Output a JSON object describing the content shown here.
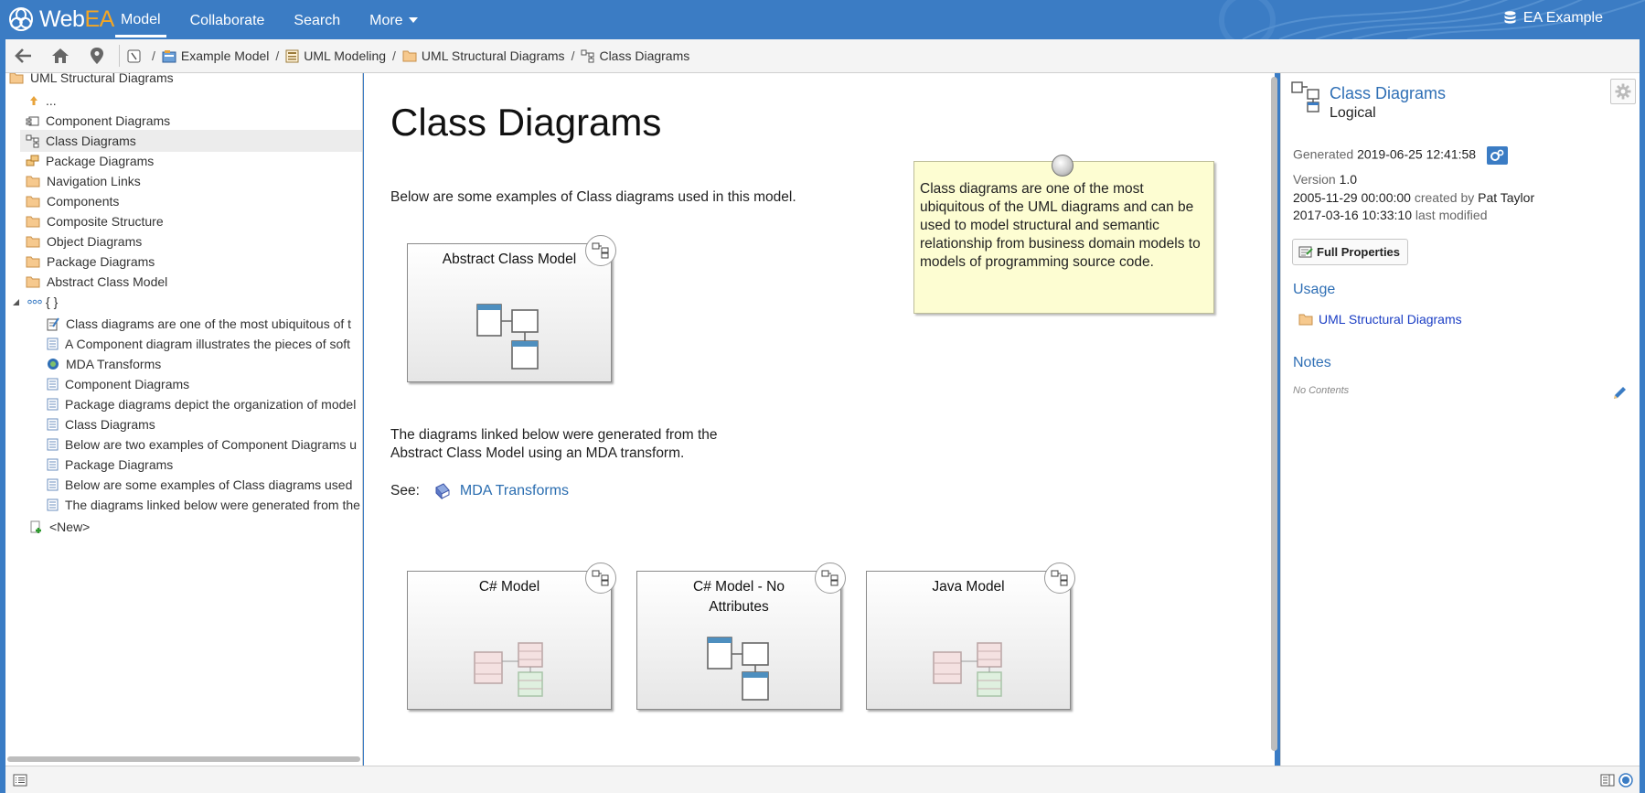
{
  "app": {
    "brand_a": "Web",
    "brand_b": "EA",
    "model_name": "EA Example"
  },
  "menu": [
    {
      "label": "Model",
      "active": true
    },
    {
      "label": "Collaborate"
    },
    {
      "label": "Search"
    },
    {
      "label": "More",
      "dropdown": true
    }
  ],
  "breadcrumb": [
    "Example Model",
    "UML Modeling",
    "UML Structural Diagrams",
    "Class Diagrams"
  ],
  "tree": {
    "root": "UML Structural Diagrams",
    "up": "...",
    "items": [
      {
        "label": "Component Diagrams",
        "icon": "component-diagram-icon"
      },
      {
        "label": "Class Diagrams",
        "icon": "class-diagram-icon",
        "selected": true
      },
      {
        "label": "Package Diagrams",
        "icon": "package-diagram-icon"
      },
      {
        "label": "Navigation Links",
        "icon": "folder-icon"
      },
      {
        "label": "Components",
        "icon": "folder-icon"
      },
      {
        "label": "Composite Structure",
        "icon": "folder-icon"
      },
      {
        "label": "Object Diagrams",
        "icon": "folder-icon"
      },
      {
        "label": "Package Diagrams",
        "icon": "folder-icon"
      },
      {
        "label": "Abstract Class Model",
        "icon": "folder-icon"
      }
    ],
    "group_label": "{ }",
    "group_items": [
      {
        "label": "Class diagrams are one of the most ubiquitous of t",
        "icon": "note-icon"
      },
      {
        "label": "A Component diagram illustrates the pieces of soft",
        "icon": "text-icon"
      },
      {
        "label": "MDA Transforms",
        "icon": "hyperlink-icon"
      },
      {
        "label": "Component Diagrams",
        "icon": "text-icon"
      },
      {
        "label": "Package diagrams depict the organization of model",
        "icon": "text-icon"
      },
      {
        "label": "Class Diagrams",
        "icon": "text-icon"
      },
      {
        "label": "Below are two examples of Component Diagrams u",
        "icon": "text-icon"
      },
      {
        "label": "Package Diagrams",
        "icon": "text-icon"
      },
      {
        "label": "Below are some examples of Class diagrams used",
        "icon": "text-icon"
      },
      {
        "label": "The diagrams linked below were generated from the",
        "icon": "text-icon"
      }
    ],
    "new_label": "<New>"
  },
  "diagram": {
    "title": "Class Diagrams",
    "intro": "Below are some examples of Class diagrams used in this model.",
    "note": "Class diagrams are one of the most ubiquitous of the UML diagrams and can be used to model structural and semantic relationship from business domain models to models of programming source code.",
    "abstract_frame": "Abstract Class Model",
    "generated_line1": "The diagrams linked below were generated from the",
    "generated_line2": "Abstract Class Model using an MDA transform.",
    "see_label": "See:",
    "see_link": "MDA Transforms",
    "frames": [
      {
        "title": "C# Model",
        "style": "pastel"
      },
      {
        "title": "C# Model - No Attributes",
        "style": "plain"
      },
      {
        "title": "Java Model",
        "style": "pastel"
      }
    ]
  },
  "properties": {
    "name": "Class Diagrams",
    "type": "Logical",
    "generated_label": "Generated",
    "generated": "2019-06-25 12:41:58",
    "version_label": "Version",
    "version": "1.0",
    "created": "2005-11-29 00:00:00",
    "created_by_label": "created by",
    "author": "Pat Taylor",
    "modified": "2017-03-16 10:33:10",
    "modified_label": "last modified",
    "full_properties": "Full Properties",
    "usage_heading": "Usage",
    "usage_link": "UML Structural Diagrams",
    "notes_heading": "Notes",
    "notes_empty": "No Contents"
  },
  "colors": {
    "header": "#3b7cc4",
    "link": "#2f6fb5",
    "note_bg": "#fdfdd2",
    "folder": "#f2c28a"
  }
}
